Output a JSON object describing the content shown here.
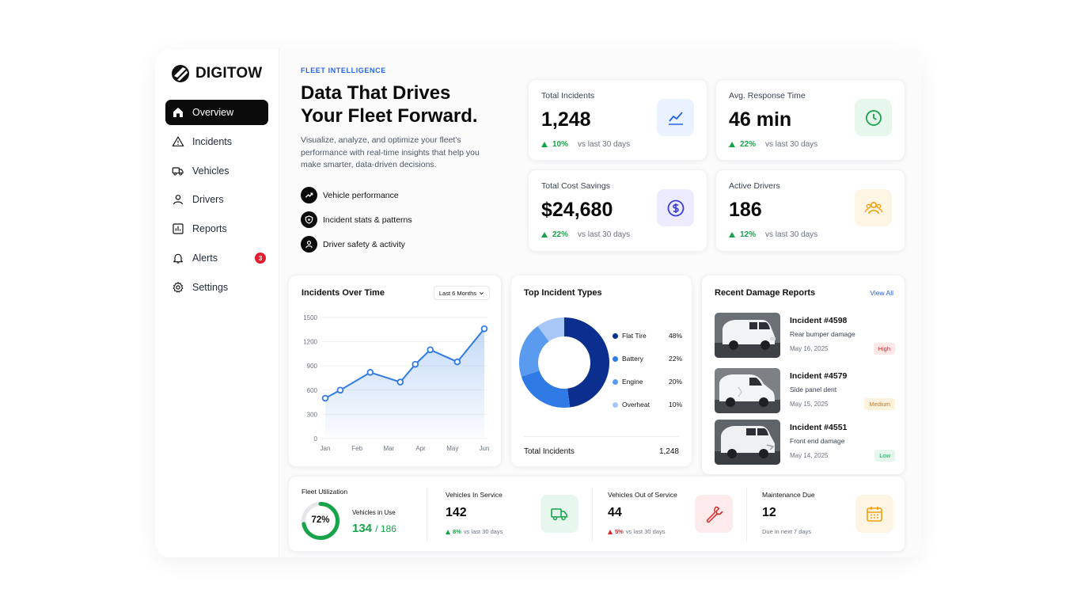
{
  "brand": {
    "name": "DIGITOW"
  },
  "sidebar": {
    "items": [
      {
        "label": "Overview",
        "icon": "home-icon",
        "active": true
      },
      {
        "label": "Incidents",
        "icon": "warning-icon"
      },
      {
        "label": "Vehicles",
        "icon": "truck-icon"
      },
      {
        "label": "Drivers",
        "icon": "user-icon"
      },
      {
        "label": "Reports",
        "icon": "bar-chart-icon"
      },
      {
        "label": "Alerts",
        "icon": "bell-icon",
        "badge": "3"
      },
      {
        "label": "Settings",
        "icon": "gear-icon"
      }
    ]
  },
  "hero": {
    "tag": "FLEET INTELLIGENCE",
    "title_line1": "Data That Drives",
    "title_line2": "Your Fleet Forward.",
    "description": "Visualize, analyze, and optimize your fleet's performance with real-time insights that help you make smarter, data-driven decisions.",
    "features": [
      {
        "label": "Vehicle performance",
        "icon": "trend-icon"
      },
      {
        "label": "Incident stats & patterns",
        "icon": "shield-icon"
      },
      {
        "label": "Driver safety & activity",
        "icon": "user-icon"
      }
    ]
  },
  "stats": [
    {
      "label": "Total Incidents",
      "value": "1,248",
      "change": "10%",
      "period": "vs last 30 days",
      "icon": "line-chart-icon",
      "icon_color": "#2563eb",
      "bg": "#eaf1ff"
    },
    {
      "label": "Avg. Response Time",
      "value": "46 min",
      "change": "22%",
      "period": "vs last 30 days",
      "icon": "clock-icon",
      "icon_color": "#16a34a",
      "bg": "#e8f7ee"
    },
    {
      "label": "Total Cost Savings",
      "value": "$24,680",
      "change": "22%",
      "period": "vs last 30 days",
      "icon": "dollar-icon",
      "icon_color": "#3b3fd8",
      "bg": "#ecebff"
    },
    {
      "label": "Active Drivers",
      "value": "186",
      "change": "12%",
      "period": "vs last 30 days",
      "icon": "users-icon",
      "icon_color": "#f59e0b",
      "bg": "#fff5e5"
    }
  ],
  "incidents_over_time": {
    "title": "Incidents Over Time",
    "range_select": "Last 6 Months",
    "y_ticks": [
      "1500",
      "1200",
      "900",
      "600",
      "300",
      "0"
    ]
  },
  "chart_data": [
    {
      "type": "line",
      "title": "Incidents Over Time",
      "x": [
        "",
        "Jan",
        "",
        "Feb",
        "",
        "Mar",
        "",
        "Apr",
        "",
        "May",
        "",
        "Jun"
      ],
      "x_tick_labels": [
        "Jan",
        "Feb",
        "Mar",
        "Apr",
        "May",
        "Jun"
      ],
      "values": [
        500,
        600,
        820,
        700,
        920,
        1100,
        950,
        1360
      ],
      "x_positions": [
        0,
        0.5,
        1.5,
        2.5,
        3,
        3.5,
        4.4,
        5.3
      ],
      "ylim": [
        0,
        1500
      ],
      "y_ticks": [
        0,
        300,
        600,
        900,
        1200,
        1500
      ],
      "color": "#2f7ae5",
      "area_fill": true
    },
    {
      "type": "pie",
      "title": "Top Incident Types",
      "labels": [
        "Flat Tire",
        "Battery",
        "Engine",
        "Overheat"
      ],
      "values": [
        48,
        22,
        20,
        10
      ],
      "value_labels": [
        "48%",
        "22%",
        "20%",
        "10%"
      ],
      "colors": [
        "#0b2f8f",
        "#2f7ae5",
        "#5a9bf0",
        "#a7c8f7"
      ],
      "donut": true
    }
  ],
  "incident_types": {
    "title": "Top Incident Types",
    "total_label": "Total Incidents",
    "total_value": "1,248"
  },
  "damage_reports": {
    "title": "Recent Damage Reports",
    "view_all": "View All",
    "items": [
      {
        "id": "Incident #4598",
        "desc": "Rear bumper damage",
        "date": "May 16, 2025",
        "severity": "High",
        "sev_fg": "#dc2626",
        "sev_bg": "#fde8e8"
      },
      {
        "id": "Incident #4579",
        "desc": "Side panel dent",
        "date": "May 15, 2025",
        "severity": "Medium",
        "sev_fg": "#d97706",
        "sev_bg": "#fef3dc"
      },
      {
        "id": "Incident #4551",
        "desc": "Front end damage",
        "date": "May 14, 2025",
        "severity": "Low",
        "sev_fg": "#16a34a",
        "sev_bg": "#e5f7ec"
      }
    ]
  },
  "bottom": {
    "utilization": {
      "label": "Fleet Utilization",
      "percent": 72,
      "percent_text": "72%",
      "in_use_label": "Vehicles in Use",
      "in_use": "134",
      "total": "/ 186"
    },
    "in_service": {
      "label": "Vehicles In Service",
      "value": "142",
      "change": "8%",
      "period": "vs last 30 days",
      "icon": "truck-icon"
    },
    "out_of_service": {
      "label": "Vehicles Out of Service",
      "value": "44",
      "change": "5%",
      "period": "vs last 30 days",
      "icon": "wrench-icon"
    },
    "maintenance": {
      "label": "Maintenance Due",
      "value": "12",
      "sub": "Due in next 7 days",
      "icon": "calendar-icon"
    }
  }
}
